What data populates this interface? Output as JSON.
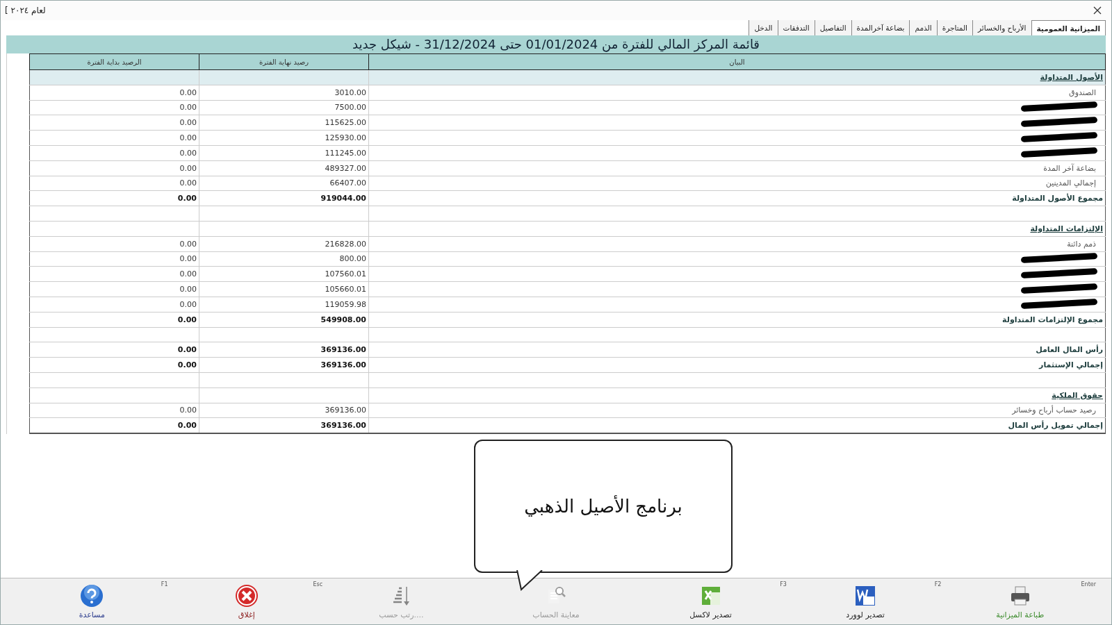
{
  "window": {
    "title": "لعام ٢٠٢٤ ]"
  },
  "tabs": [
    {
      "label": "الميزانية العمومية",
      "selected": true
    },
    {
      "label": "الأرباح والخسائر",
      "selected": false
    },
    {
      "label": "المتاجرة",
      "selected": false
    },
    {
      "label": "الذمم",
      "selected": false
    },
    {
      "label": "بضاعة آخرالمدة",
      "selected": false
    },
    {
      "label": "التفاصيل",
      "selected": false
    },
    {
      "label": "التدفقات",
      "selected": false
    },
    {
      "label": "الدخل",
      "selected": false
    }
  ],
  "report": {
    "title": "قائمة المركز المالي للفترة من 01/01/2024 حتى 31/12/2024 - شيكل جديد",
    "columns": [
      "البيان",
      "رصيد نهاية الفترة",
      "الرصيد بداية الفترة"
    ],
    "rows": [
      {
        "kind": "section",
        "label": "الأصول المتداولة",
        "selected": true
      },
      {
        "kind": "item",
        "label": "الصندوق",
        "end": "3010.00",
        "start": "0.00",
        "selected": false
      },
      {
        "kind": "item",
        "redacted": true,
        "end": "7500.00",
        "start": "0.00",
        "selected": false
      },
      {
        "kind": "item",
        "redacted": true,
        "end": "115625.00",
        "start": "0.00",
        "selected": false
      },
      {
        "kind": "item",
        "redacted": true,
        "end": "125930.00",
        "start": "0.00",
        "selected": false
      },
      {
        "kind": "item",
        "redacted": true,
        "end": "111245.00",
        "start": "0.00",
        "selected": false
      },
      {
        "kind": "item",
        "label": "بضاعة آخر المدة",
        "end": "489327.00",
        "start": "0.00",
        "selected": false
      },
      {
        "kind": "item",
        "label": "إجمالي المدينين",
        "end": "66407.00",
        "start": "0.00",
        "selected": false
      },
      {
        "kind": "total",
        "label": "مجموع الأصول المتداولة",
        "end": "919044.00",
        "start": "0.00",
        "selected": false
      },
      {
        "kind": "blank",
        "selected": false
      },
      {
        "kind": "section",
        "label": "الإلتزامات المتداولة",
        "selected": false
      },
      {
        "kind": "item",
        "label": "ذمم دائنة",
        "end": "216828.00",
        "start": "0.00",
        "selected": false
      },
      {
        "kind": "item",
        "redacted": true,
        "end": "800.00",
        "start": "0.00",
        "selected": false
      },
      {
        "kind": "item",
        "redacted": true,
        "end": "107560.01",
        "start": "0.00",
        "selected": false
      },
      {
        "kind": "item",
        "redacted": true,
        "end": "105660.01",
        "start": "0.00",
        "selected": false
      },
      {
        "kind": "item",
        "redacted": true,
        "end": "119059.98",
        "start": "0.00",
        "selected": false
      },
      {
        "kind": "total",
        "label": "مجموع الإلتزامات المتداولة",
        "end": "549908.00",
        "start": "0.00",
        "selected": false
      },
      {
        "kind": "blank",
        "selected": false
      },
      {
        "kind": "total",
        "label": "رأس المال العامل",
        "end": "369136.00",
        "start": "0.00",
        "selected": false
      },
      {
        "kind": "total",
        "label": "إجمالي الإستثمار",
        "end": "369136.00",
        "start": "0.00",
        "selected": false
      },
      {
        "kind": "blank",
        "selected": false
      },
      {
        "kind": "section",
        "label": "حقوق الملكية",
        "selected": false
      },
      {
        "kind": "item",
        "label": "رصيد حساب أرباح وخسائر",
        "end": "369136.00",
        "start": "0.00",
        "selected": false
      },
      {
        "kind": "total",
        "label": "إجمالي تمويل رأس المال",
        "end": "369136.00",
        "start": "0.00",
        "selected": false
      }
    ]
  },
  "callout": {
    "text": "برنامج الأصيل الذهبي"
  },
  "toolbar": [
    {
      "kind": "print",
      "label": "طباعة الميزانية",
      "key": "Enter",
      "disabled": false,
      "color": "#3a8a2a"
    },
    {
      "kind": "word",
      "label": "تصدير لوورد",
      "key": "F2",
      "disabled": false,
      "color": "#222222"
    },
    {
      "kind": "excel",
      "label": "تصدير لاكسل",
      "key": "F3",
      "disabled": false,
      "color": "#222222"
    },
    {
      "kind": "preview",
      "label": "معاينة الحساب",
      "disabled": true
    },
    {
      "kind": "sort",
      "label": "....رتب حسب",
      "disabled": true
    },
    {
      "kind": "close",
      "label": "إغلاق",
      "key": "Esc",
      "disabled": false,
      "color": "#8a1a1a"
    },
    {
      "kind": "help",
      "label": "مساعدة",
      "key": "F1",
      "disabled": false,
      "color": "#2a3a8c"
    }
  ]
}
